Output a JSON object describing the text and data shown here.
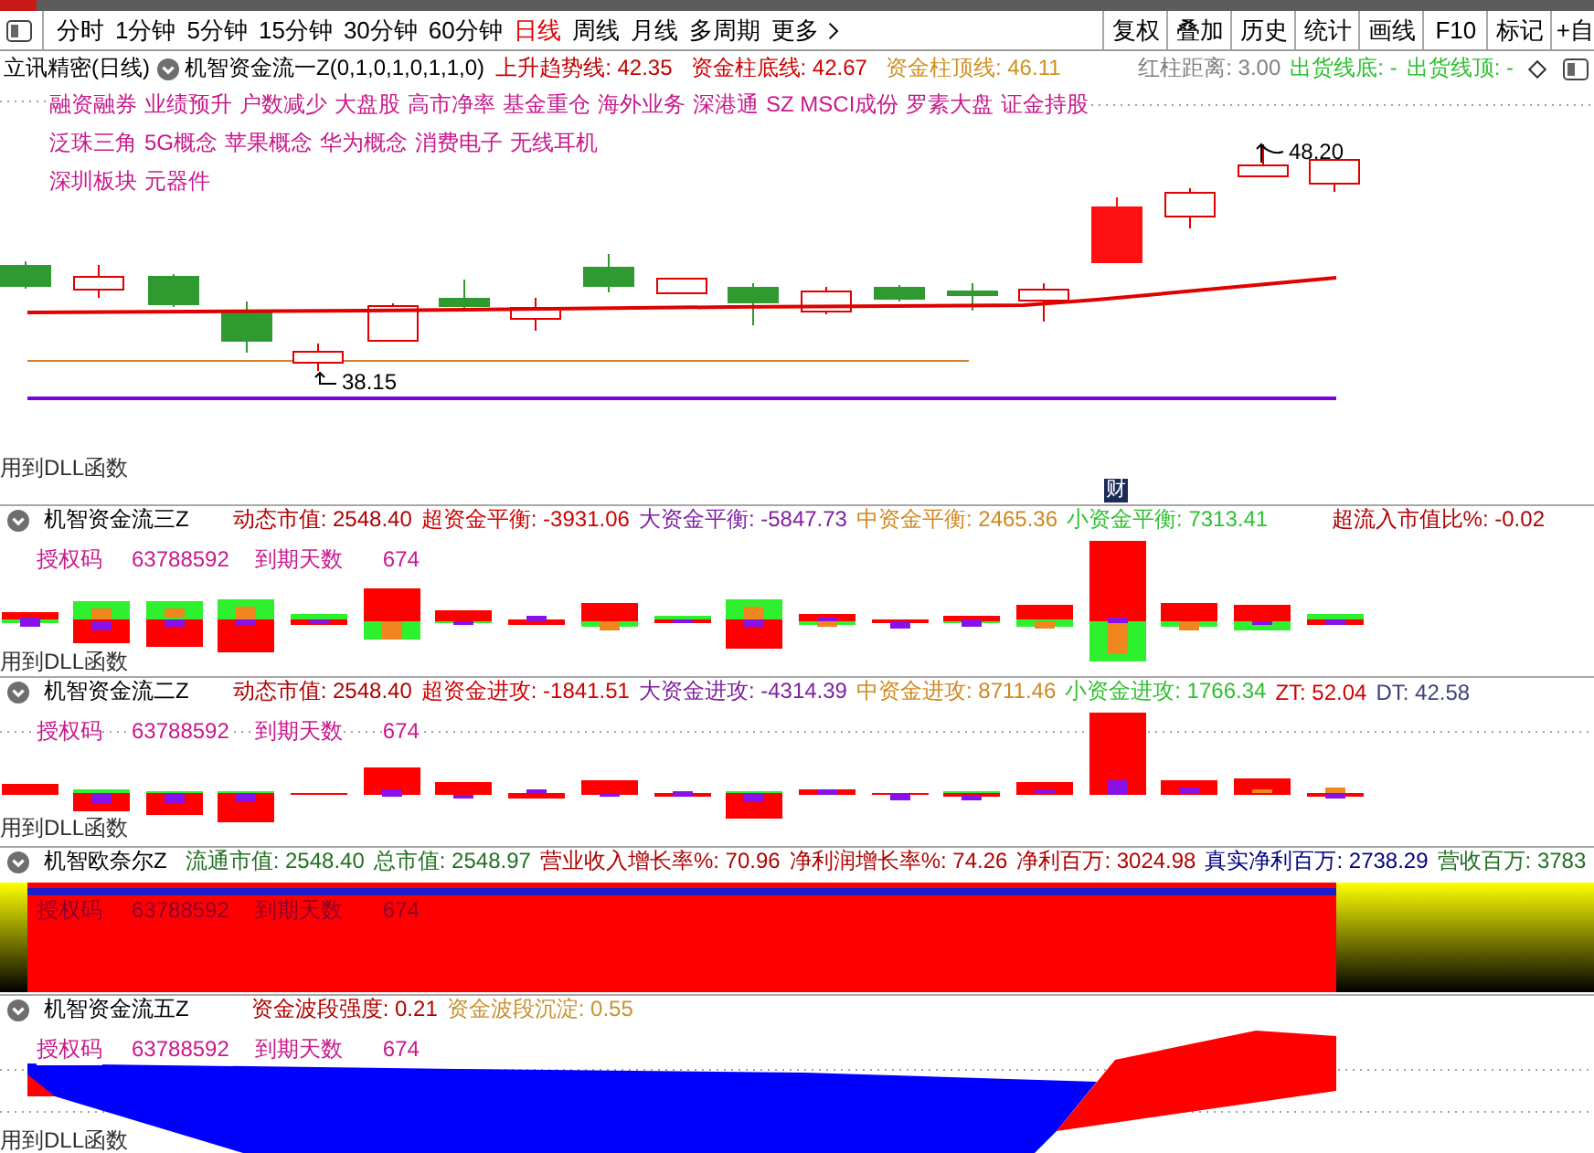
{
  "toolbar": {
    "periods": [
      {
        "label": "分时",
        "selected": false
      },
      {
        "label": "1分钟",
        "selected": false
      },
      {
        "label": "5分钟",
        "selected": false
      },
      {
        "label": "15分钟",
        "selected": false
      },
      {
        "label": "30分钟",
        "selected": false
      },
      {
        "label": "60分钟",
        "selected": false
      },
      {
        "label": "日线",
        "selected": true
      },
      {
        "label": "周线",
        "selected": false
      },
      {
        "label": "月线",
        "selected": false
      },
      {
        "label": "多周期",
        "selected": false
      }
    ],
    "more": "更多",
    "tools": [
      "复权",
      "叠加",
      "历史",
      "统计",
      "画线",
      "F10",
      "标记",
      "+自"
    ]
  },
  "main_panel": {
    "stock": "立讯精密(日线)",
    "indicator": "机智资金流一Z(0,1,0,1,0,1,1,0)",
    "readings": [
      {
        "text": "上升趋势线: 42.35",
        "color": "#c00000"
      },
      {
        "text": "资金柱底线: 42.67",
        "color": "#d00000"
      },
      {
        "text": "资金柱顶线: 46.11",
        "color": "#d09020"
      }
    ],
    "right_readings": [
      {
        "text": "红柱距离: 3.00",
        "color": "#808080"
      },
      {
        "text": "出货线底: -",
        "color": "#30c030"
      },
      {
        "text": "出货线顶: -",
        "color": "#30c030"
      }
    ],
    "tag_rows": [
      [
        "融资融券",
        "业绩预升",
        "户数减少",
        "大盘股",
        "高市净率",
        "基金重仓",
        "海外业务",
        "深港通",
        "SZ MSCI成份",
        "罗素大盘",
        "证金持股"
      ],
      [
        "泛珠三角",
        "5G概念",
        "苹果概念",
        "华为概念",
        "消费电子",
        "无线耳机"
      ],
      [
        "深圳板块",
        "元器件"
      ]
    ],
    "high_label": "48.20",
    "low_label": "38.15",
    "event_badge": "财",
    "footer": "用到DLL函数"
  },
  "panels": [
    {
      "kind": "balance",
      "name": "机智资金流三Z",
      "readings": [
        {
          "text": "动态市值: 2548.40",
          "color": "#b00000"
        },
        {
          "text": "超资金平衡: -3931.06",
          "color": "#d00000"
        },
        {
          "text": "大资金平衡: -5847.73",
          "color": "#8020a0"
        },
        {
          "text": "中资金平衡: 2465.36",
          "color": "#d08820"
        },
        {
          "text": "小资金平衡: 7313.41",
          "color": "#30c030"
        }
      ],
      "right_readings": [
        {
          "text": "超流入市值比%: -0.02",
          "color": "#b00000"
        }
      ],
      "auth": {
        "label": "授权码",
        "code": "63788592",
        "expiry_label": "到期天数",
        "days": "674"
      },
      "footer": "用到DLL函数"
    },
    {
      "kind": "attack",
      "name": "机智资金流二Z",
      "readings": [
        {
          "text": "动态市值: 2548.40",
          "color": "#b00000"
        },
        {
          "text": "超资金进攻: -1841.51",
          "color": "#d00000"
        },
        {
          "text": "大资金进攻: -4314.39",
          "color": "#8020a0"
        },
        {
          "text": "中资金进攻: 8711.46",
          "color": "#d08820"
        },
        {
          "text": "小资金进攻: 1766.34",
          "color": "#30c030"
        },
        {
          "text": "ZT: 52.04",
          "color": "#d00000"
        },
        {
          "text": "DT: 42.58",
          "color": "#404080"
        }
      ],
      "auth": {
        "label": "授权码",
        "code": "63788592",
        "expiry_label": "到期天数",
        "days": "674"
      },
      "footer": "用到DLL函数"
    },
    {
      "kind": "band",
      "name": "机智欧奈尔Z",
      "readings": [
        {
          "text": "流通市值: 2548.40",
          "color": "#207020"
        },
        {
          "text": "总市值: 2548.97",
          "color": "#207020"
        },
        {
          "text": "营业收入增长率%: 70.96",
          "color": "#b00000"
        },
        {
          "text": "净利润增长率%: 74.26",
          "color": "#b00000"
        },
        {
          "text": "净利百万: 3024.98",
          "color": "#b00000"
        },
        {
          "text": "真实净利百万: 2738.29",
          "color": "#000080"
        },
        {
          "text": "营收百万: 3783",
          "color": "#207020"
        }
      ],
      "auth": {
        "label": "授权码",
        "code": "63788592",
        "expiry_label": "到期天数",
        "days": "674"
      }
    },
    {
      "kind": "wave",
      "name": "机智资金流五Z",
      "readings": [
        {
          "text": "资金波段强度: 0.21",
          "color": "#b00000"
        },
        {
          "text": "资金波段沉淀: 0.55",
          "color": "#c89030"
        }
      ],
      "auth": {
        "label": "授权码",
        "code": "63788592",
        "expiry_label": "到期天数",
        "days": "674"
      },
      "footer": "用到DLL函数"
    }
  ]
}
